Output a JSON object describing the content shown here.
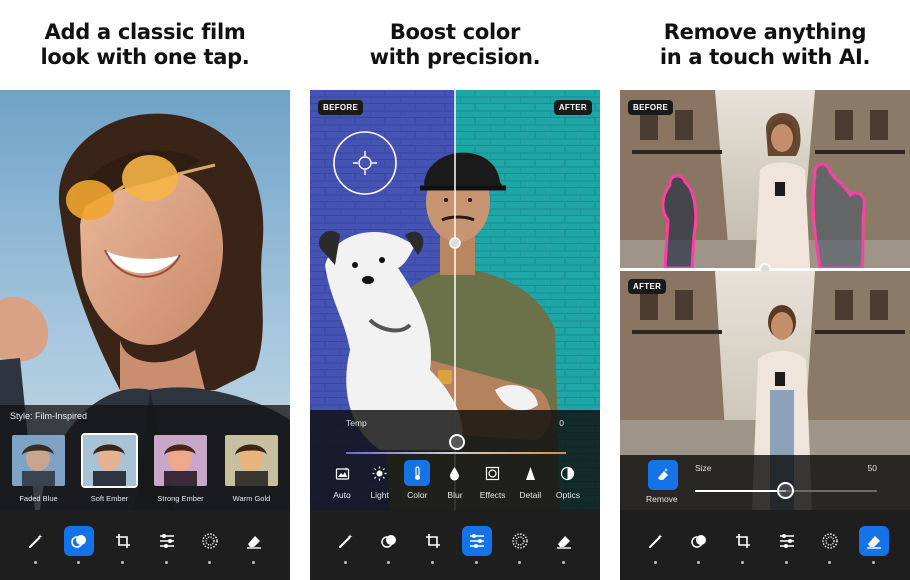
{
  "colors": {
    "accent": "#1473e6",
    "toolbar_bg": "#1e1e1e",
    "outline_pink": "#ff3fa4"
  },
  "panels": [
    {
      "headline": "Add a classic film\nlook with one tap.",
      "style_label": "Style: Film-Inspired",
      "presets": [
        "Faded Blue",
        "Soft Ember",
        "Strong Ember",
        "Warm Gold"
      ],
      "selected_preset": "Soft Ember",
      "active_tool": "presets"
    },
    {
      "headline": "Boost color\nwith precision.",
      "before_badge": "BEFORE",
      "after_badge": "AFTER",
      "temp_label": "Temp",
      "temp_value": "0",
      "adjust_tabs": [
        "Auto",
        "Light",
        "Color",
        "Blur",
        "Effects",
        "Detail",
        "Optics"
      ],
      "active_adjust": "Color",
      "active_tool": "adjust"
    },
    {
      "headline": "Remove anything\nin a touch with AI.",
      "before_badge": "BEFORE",
      "after_badge": "AFTER",
      "remove_label": "Remove",
      "size_label": "Size",
      "size_value": "50",
      "active_tool": "remove"
    }
  ],
  "toolbar_icons": [
    "magic-wand-icon",
    "presets-icon",
    "crop-icon",
    "adjust-sliders-icon",
    "vignette-icon",
    "eraser-icon"
  ]
}
